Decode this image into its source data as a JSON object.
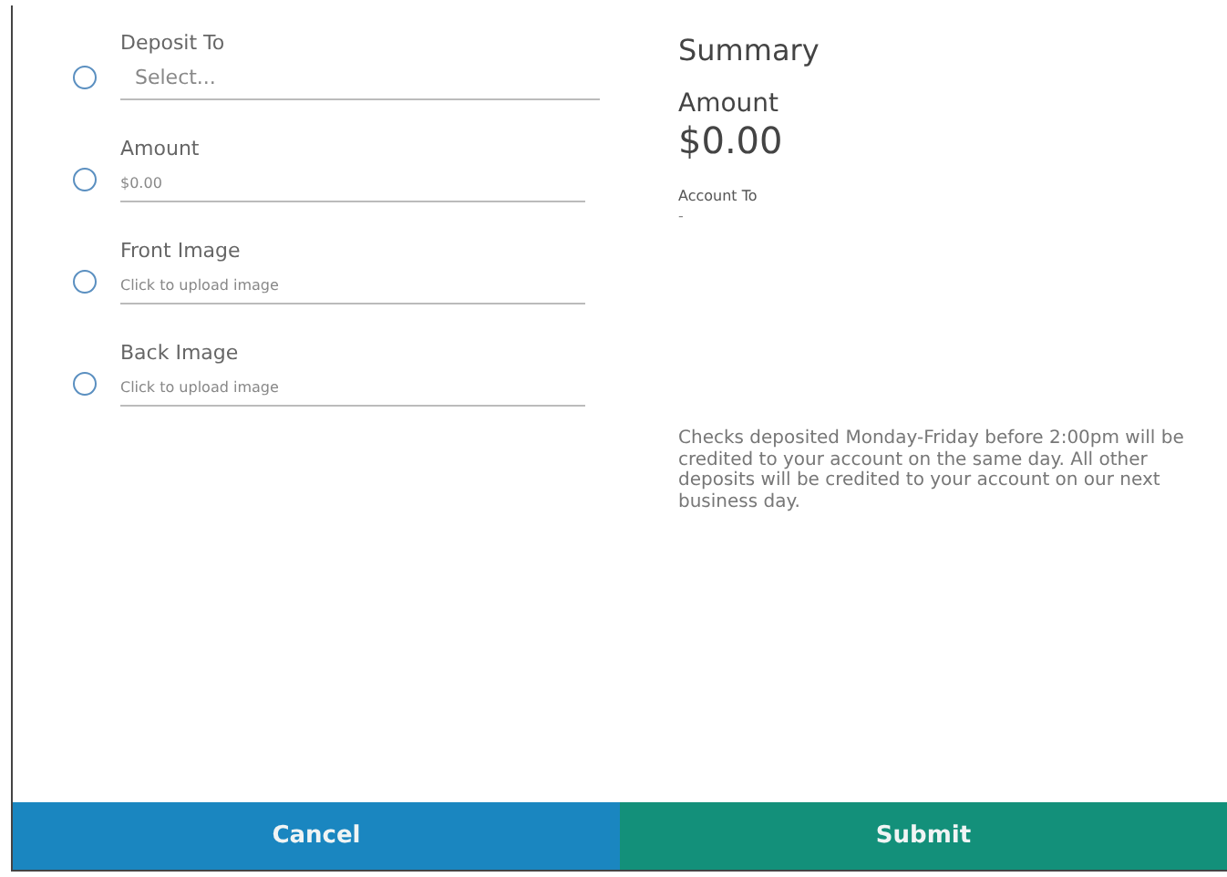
{
  "fields": [
    {
      "kind": "select",
      "label": "Deposit To",
      "placeholder": "Select...",
      "selected": false
    },
    {
      "kind": "amount",
      "label": "Amount",
      "placeholder": "$0.00",
      "selected": false
    },
    {
      "kind": "upload",
      "label": "Front Image",
      "placeholder": "Click to upload image",
      "selected": false
    },
    {
      "kind": "upload",
      "label": "Back Image",
      "placeholder": "Click to upload image",
      "selected": false
    }
  ],
  "summary": {
    "title": "Summary",
    "amount_label": "Amount",
    "amount": "$0.00",
    "account_label": "Account To",
    "account": "-",
    "note": "Checks deposited Monday-Friday before 2:00pm will be credited to your account on the same day. All other deposits will be credited to your account on our next business day."
  },
  "buttons": [
    {
      "kind": "cancel",
      "label": "Cancel"
    },
    {
      "kind": "submit",
      "label": "Submit"
    }
  ]
}
